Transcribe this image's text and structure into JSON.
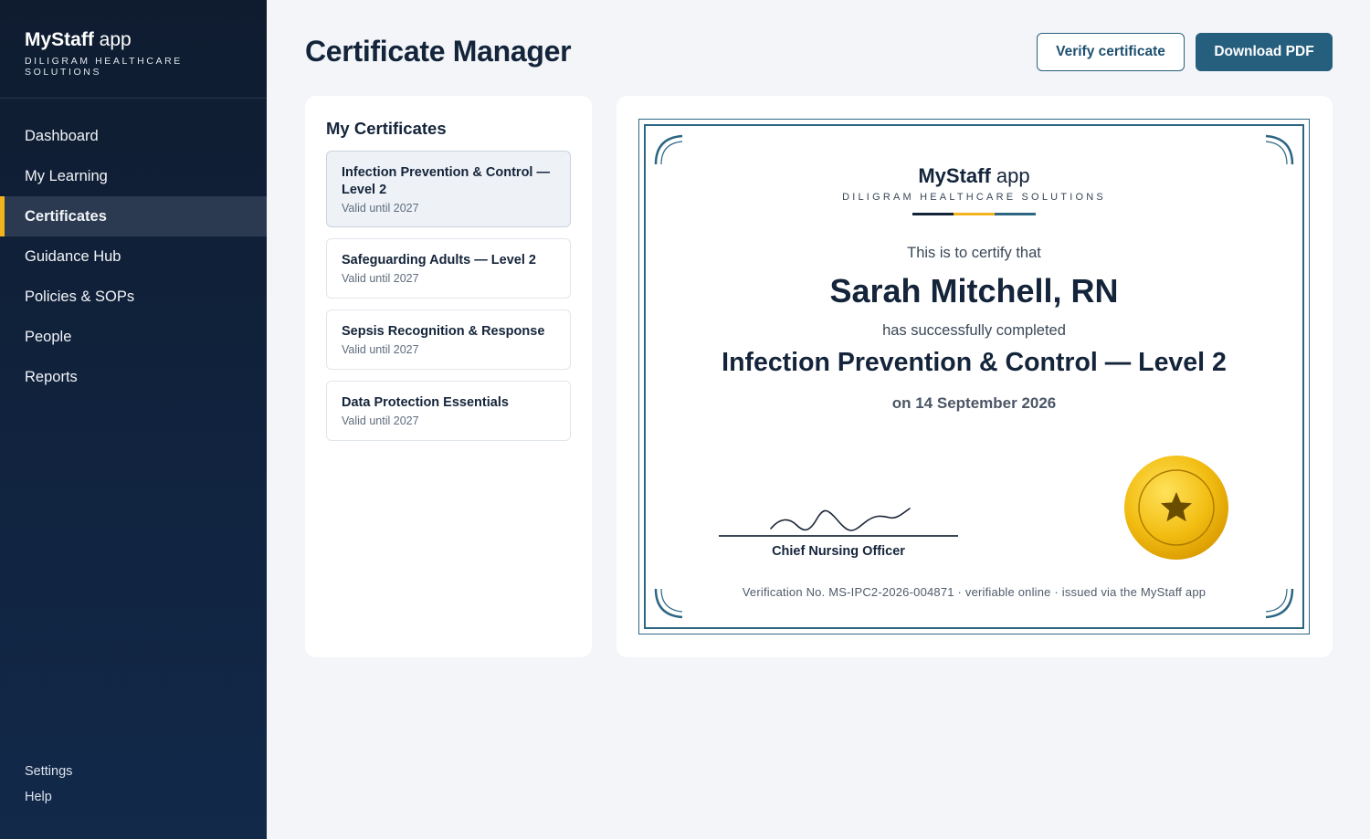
{
  "sidebar": {
    "brand_name_bold": "MyStaff",
    "brand_name_rest": " app",
    "brand_subtitle": "DILIGRAM HEALTHCARE SOLUTIONS",
    "nav": [
      {
        "label": "Dashboard"
      },
      {
        "label": "My Learning"
      },
      {
        "label": "Certificates",
        "active": true
      },
      {
        "label": "Guidance Hub"
      },
      {
        "label": "Policies & SOPs"
      },
      {
        "label": "People"
      },
      {
        "label": "Reports"
      }
    ],
    "bottom": [
      {
        "label": "Settings"
      },
      {
        "label": "Help"
      }
    ],
    "accent_color": "#f2b31d"
  },
  "header": {
    "title": "Certificate Manager",
    "verify_label": "Verify certificate",
    "download_label": "Download PDF"
  },
  "certificates": {
    "title": "My Certificates",
    "items": [
      {
        "title": "Infection Prevention & Control — Level 2",
        "valid": "Valid until 2027",
        "selected": true
      },
      {
        "title": "Safeguarding Adults — Level 2",
        "valid": "Valid until 2027"
      },
      {
        "title": "Sepsis Recognition & Response",
        "valid": "Valid until 2027"
      },
      {
        "title": "Data Protection Essentials",
        "valid": "Valid until 2027"
      }
    ]
  },
  "preview": {
    "brand_bold": "MyStaff",
    "brand_rest": " app",
    "brand_subtitle": "DILIGRAM HEALTHCARE SOLUTIONS",
    "bar_colors": [
      "#14243a",
      "#f2b31d",
      "#2c6683"
    ],
    "intro": "This is to certify that",
    "recipient": "Sarah Mitchell, RN",
    "completed_text": "has successfully completed",
    "course": "Infection Prevention & Control — Level 2",
    "date_line": "on 14 September 2026",
    "signatory_title": "Chief Nursing Officer",
    "seal_icon": "star-icon",
    "footer": "Verification No. MS-IPC2-2026-004871 · verifiable online · issued via the MyStaff app",
    "frame_color": "#2c6683"
  }
}
